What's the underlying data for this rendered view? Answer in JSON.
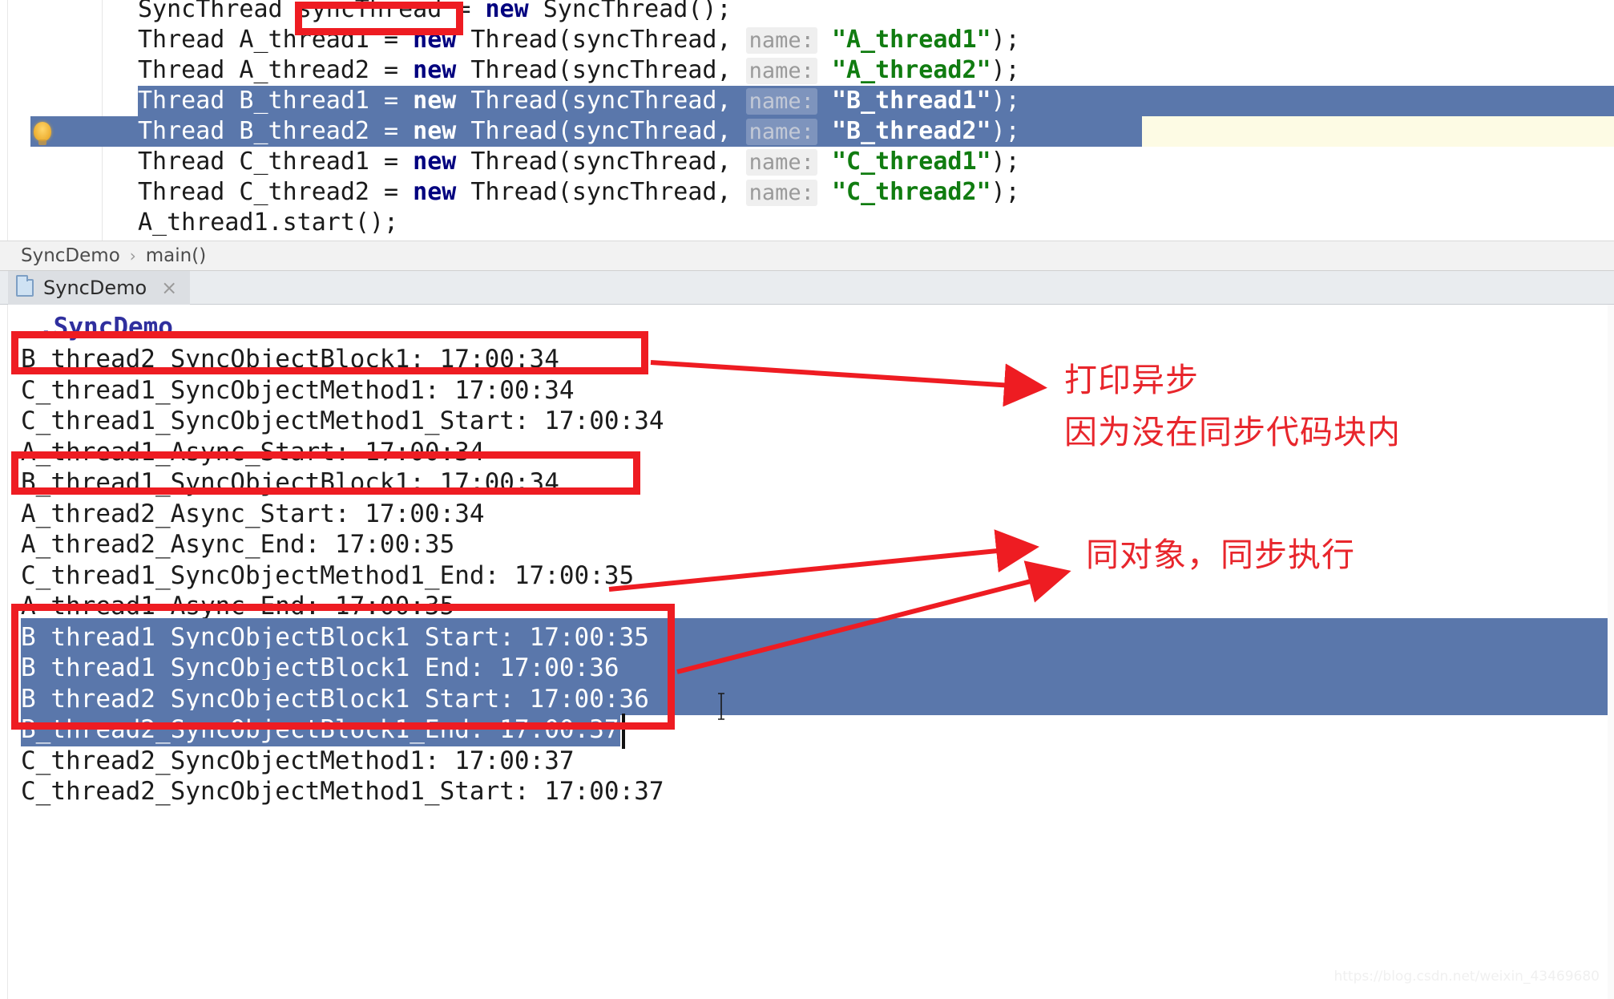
{
  "editor": {
    "lines": [
      {
        "id": "line-sync-thread-decl",
        "indent": 172,
        "selected": false,
        "segments": [
          {
            "t": "SyncThread ",
            "k": "plain"
          },
          {
            "t": "syncThread",
            "k": "plain"
          },
          {
            "t": " = ",
            "k": "plain"
          },
          {
            "t": "new",
            "k": "kw"
          },
          {
            "t": " SyncThread();",
            "k": "plain"
          }
        ]
      },
      {
        "id": "line-a-thread1",
        "indent": 172,
        "selected": false,
        "segments": [
          {
            "t": "Thread A_thread1 = ",
            "k": "plain"
          },
          {
            "t": "new",
            "k": "kw"
          },
          {
            "t": " Thread(syncThread, ",
            "k": "plain"
          },
          {
            "t": "name:",
            "k": "hint"
          },
          {
            "t": " ",
            "k": "plain"
          },
          {
            "t": "\"A_thread1\"",
            "k": "str"
          },
          {
            "t": ");",
            "k": "plain"
          }
        ]
      },
      {
        "id": "line-a-thread2",
        "indent": 172,
        "selected": false,
        "segments": [
          {
            "t": "Thread A_thread2 = ",
            "k": "plain"
          },
          {
            "t": "new",
            "k": "kw"
          },
          {
            "t": " Thread(syncThread, ",
            "k": "plain"
          },
          {
            "t": "name:",
            "k": "hint"
          },
          {
            "t": " ",
            "k": "plain"
          },
          {
            "t": "\"A_thread2\"",
            "k": "str"
          },
          {
            "t": ");",
            "k": "plain"
          }
        ]
      },
      {
        "id": "line-b-thread1",
        "indent": 172,
        "selected": true,
        "segments": [
          {
            "t": "Thread B_thread1 = ",
            "k": "plain"
          },
          {
            "t": "new",
            "k": "kw"
          },
          {
            "t": " Thread(syncThread, ",
            "k": "plain"
          },
          {
            "t": "name:",
            "k": "hint"
          },
          {
            "t": " ",
            "k": "plain"
          },
          {
            "t": "\"B_thread1\"",
            "k": "str"
          },
          {
            "t": ");",
            "k": "plain"
          }
        ]
      },
      {
        "id": "line-b-thread2",
        "indent": 172,
        "selected": true,
        "segments": [
          {
            "t": "Thread B_thread2 = ",
            "k": "plain"
          },
          {
            "t": "new",
            "k": "kw"
          },
          {
            "t": " Thread(syncThread, ",
            "k": "plain"
          },
          {
            "t": "name:",
            "k": "hint"
          },
          {
            "t": " ",
            "k": "plain"
          },
          {
            "t": "\"B_thread2\"",
            "k": "str"
          },
          {
            "t": ");",
            "k": "plain"
          }
        ]
      },
      {
        "id": "line-c-thread1",
        "indent": 172,
        "selected": false,
        "segments": [
          {
            "t": "Thread C_thread1 = ",
            "k": "plain"
          },
          {
            "t": "new",
            "k": "kw"
          },
          {
            "t": " Thread(syncThread, ",
            "k": "plain"
          },
          {
            "t": "name:",
            "k": "hint"
          },
          {
            "t": " ",
            "k": "plain"
          },
          {
            "t": "\"C_thread1\"",
            "k": "str"
          },
          {
            "t": ");",
            "k": "plain"
          }
        ]
      },
      {
        "id": "line-c-thread2",
        "indent": 172,
        "selected": false,
        "segments": [
          {
            "t": "Thread C_thread2 = ",
            "k": "plain"
          },
          {
            "t": "new",
            "k": "kw"
          },
          {
            "t": " Thread(syncThread, ",
            "k": "plain"
          },
          {
            "t": "name:",
            "k": "hint"
          },
          {
            "t": " ",
            "k": "plain"
          },
          {
            "t": "\"C_thread2\"",
            "k": "str"
          },
          {
            "t": ");",
            "k": "plain"
          }
        ]
      },
      {
        "id": "line-a-thread1-start",
        "indent": 172,
        "selected": false,
        "segments": [
          {
            "t": "A_thread1.start();",
            "k": "plain"
          }
        ]
      }
    ],
    "intention_bulb": "lightbulb-icon"
  },
  "breadcrumb": {
    "class_name": "SyncDemo",
    "separator": "›",
    "method_name": "main()"
  },
  "console_tab": {
    "icon": "run-config-icon",
    "label": "SyncDemo",
    "close": "×"
  },
  "console": {
    "header_line": ".SyncDemo",
    "lines": [
      {
        "text": "B_thread2_SyncObjectBlock1: 17:00:34",
        "selected": false
      },
      {
        "text": "C_thread1_SyncObjectMethod1: 17:00:34",
        "selected": false
      },
      {
        "text": "C_thread1_SyncObjectMethod1_Start: 17:00:34",
        "selected": false
      },
      {
        "text": "A_thread1_Async_Start: 17:00:34",
        "selected": false
      },
      {
        "text": "B_thread1_SyncObjectBlock1: 17:00:34",
        "selected": false
      },
      {
        "text": "A_thread2_Async_Start: 17:00:34",
        "selected": false
      },
      {
        "text": "A_thread2_Async_End: 17:00:35",
        "selected": false
      },
      {
        "text": "C_thread1_SyncObjectMethod1_End: 17:00:35",
        "selected": false
      },
      {
        "text": "A_thread1_Async_End: 17:00:35",
        "selected": false
      },
      {
        "text": "B_thread1_SyncObjectBlock1_Start: 17:00:35",
        "selected": true
      },
      {
        "text": "B_thread1_SyncObjectBlock1_End: 17:00:36",
        "selected": true
      },
      {
        "text": "B_thread2_SyncObjectBlock1_Start: 17:00:36",
        "selected": true
      },
      {
        "text": "B_thread2_SyncObjectBlock1_End: 17:00:37",
        "selected": true
      },
      {
        "text": "C_thread2_SyncObjectMethod1: 17:00:37",
        "selected": false
      },
      {
        "text": "C_thread2_SyncObjectMethod1_Start: 17:00:37",
        "selected": false
      }
    ]
  },
  "annotations": {
    "accent_color": "#ee1c22",
    "note_1": "打印异步",
    "note_2": "因为没在同步代码块内",
    "note_3": "同对象，同步执行"
  },
  "watermark": {
    "url": "https://blog.csdn.net/weixin_43469680"
  }
}
